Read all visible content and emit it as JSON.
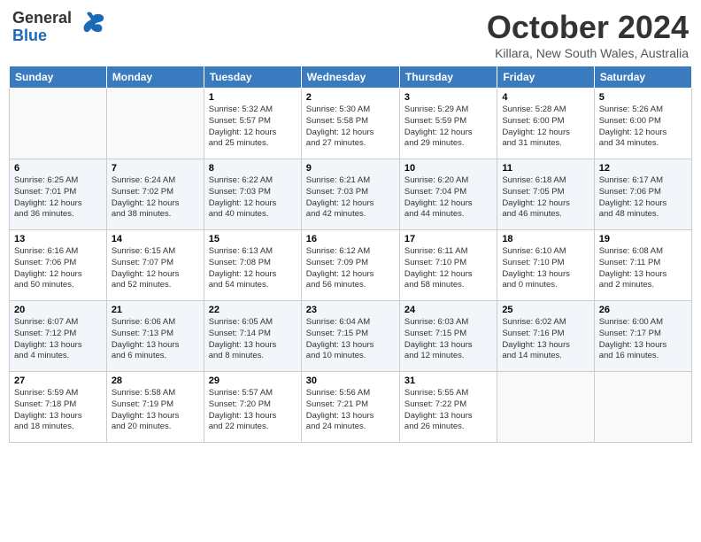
{
  "header": {
    "logo_line1": "General",
    "logo_line2": "Blue",
    "month": "October 2024",
    "location": "Killara, New South Wales, Australia"
  },
  "weekdays": [
    "Sunday",
    "Monday",
    "Tuesday",
    "Wednesday",
    "Thursday",
    "Friday",
    "Saturday"
  ],
  "weeks": [
    [
      {
        "day": "",
        "info": ""
      },
      {
        "day": "",
        "info": ""
      },
      {
        "day": "1",
        "info": "Sunrise: 5:32 AM\nSunset: 5:57 PM\nDaylight: 12 hours\nand 25 minutes."
      },
      {
        "day": "2",
        "info": "Sunrise: 5:30 AM\nSunset: 5:58 PM\nDaylight: 12 hours\nand 27 minutes."
      },
      {
        "day": "3",
        "info": "Sunrise: 5:29 AM\nSunset: 5:59 PM\nDaylight: 12 hours\nand 29 minutes."
      },
      {
        "day": "4",
        "info": "Sunrise: 5:28 AM\nSunset: 6:00 PM\nDaylight: 12 hours\nand 31 minutes."
      },
      {
        "day": "5",
        "info": "Sunrise: 5:26 AM\nSunset: 6:00 PM\nDaylight: 12 hours\nand 34 minutes."
      }
    ],
    [
      {
        "day": "6",
        "info": "Sunrise: 6:25 AM\nSunset: 7:01 PM\nDaylight: 12 hours\nand 36 minutes."
      },
      {
        "day": "7",
        "info": "Sunrise: 6:24 AM\nSunset: 7:02 PM\nDaylight: 12 hours\nand 38 minutes."
      },
      {
        "day": "8",
        "info": "Sunrise: 6:22 AM\nSunset: 7:03 PM\nDaylight: 12 hours\nand 40 minutes."
      },
      {
        "day": "9",
        "info": "Sunrise: 6:21 AM\nSunset: 7:03 PM\nDaylight: 12 hours\nand 42 minutes."
      },
      {
        "day": "10",
        "info": "Sunrise: 6:20 AM\nSunset: 7:04 PM\nDaylight: 12 hours\nand 44 minutes."
      },
      {
        "day": "11",
        "info": "Sunrise: 6:18 AM\nSunset: 7:05 PM\nDaylight: 12 hours\nand 46 minutes."
      },
      {
        "day": "12",
        "info": "Sunrise: 6:17 AM\nSunset: 7:06 PM\nDaylight: 12 hours\nand 48 minutes."
      }
    ],
    [
      {
        "day": "13",
        "info": "Sunrise: 6:16 AM\nSunset: 7:06 PM\nDaylight: 12 hours\nand 50 minutes."
      },
      {
        "day": "14",
        "info": "Sunrise: 6:15 AM\nSunset: 7:07 PM\nDaylight: 12 hours\nand 52 minutes."
      },
      {
        "day": "15",
        "info": "Sunrise: 6:13 AM\nSunset: 7:08 PM\nDaylight: 12 hours\nand 54 minutes."
      },
      {
        "day": "16",
        "info": "Sunrise: 6:12 AM\nSunset: 7:09 PM\nDaylight: 12 hours\nand 56 minutes."
      },
      {
        "day": "17",
        "info": "Sunrise: 6:11 AM\nSunset: 7:10 PM\nDaylight: 12 hours\nand 58 minutes."
      },
      {
        "day": "18",
        "info": "Sunrise: 6:10 AM\nSunset: 7:10 PM\nDaylight: 13 hours\nand 0 minutes."
      },
      {
        "day": "19",
        "info": "Sunrise: 6:08 AM\nSunset: 7:11 PM\nDaylight: 13 hours\nand 2 minutes."
      }
    ],
    [
      {
        "day": "20",
        "info": "Sunrise: 6:07 AM\nSunset: 7:12 PM\nDaylight: 13 hours\nand 4 minutes."
      },
      {
        "day": "21",
        "info": "Sunrise: 6:06 AM\nSunset: 7:13 PM\nDaylight: 13 hours\nand 6 minutes."
      },
      {
        "day": "22",
        "info": "Sunrise: 6:05 AM\nSunset: 7:14 PM\nDaylight: 13 hours\nand 8 minutes."
      },
      {
        "day": "23",
        "info": "Sunrise: 6:04 AM\nSunset: 7:15 PM\nDaylight: 13 hours\nand 10 minutes."
      },
      {
        "day": "24",
        "info": "Sunrise: 6:03 AM\nSunset: 7:15 PM\nDaylight: 13 hours\nand 12 minutes."
      },
      {
        "day": "25",
        "info": "Sunrise: 6:02 AM\nSunset: 7:16 PM\nDaylight: 13 hours\nand 14 minutes."
      },
      {
        "day": "26",
        "info": "Sunrise: 6:00 AM\nSunset: 7:17 PM\nDaylight: 13 hours\nand 16 minutes."
      }
    ],
    [
      {
        "day": "27",
        "info": "Sunrise: 5:59 AM\nSunset: 7:18 PM\nDaylight: 13 hours\nand 18 minutes."
      },
      {
        "day": "28",
        "info": "Sunrise: 5:58 AM\nSunset: 7:19 PM\nDaylight: 13 hours\nand 20 minutes."
      },
      {
        "day": "29",
        "info": "Sunrise: 5:57 AM\nSunset: 7:20 PM\nDaylight: 13 hours\nand 22 minutes."
      },
      {
        "day": "30",
        "info": "Sunrise: 5:56 AM\nSunset: 7:21 PM\nDaylight: 13 hours\nand 24 minutes."
      },
      {
        "day": "31",
        "info": "Sunrise: 5:55 AM\nSunset: 7:22 PM\nDaylight: 13 hours\nand 26 minutes."
      },
      {
        "day": "",
        "info": ""
      },
      {
        "day": "",
        "info": ""
      }
    ]
  ]
}
